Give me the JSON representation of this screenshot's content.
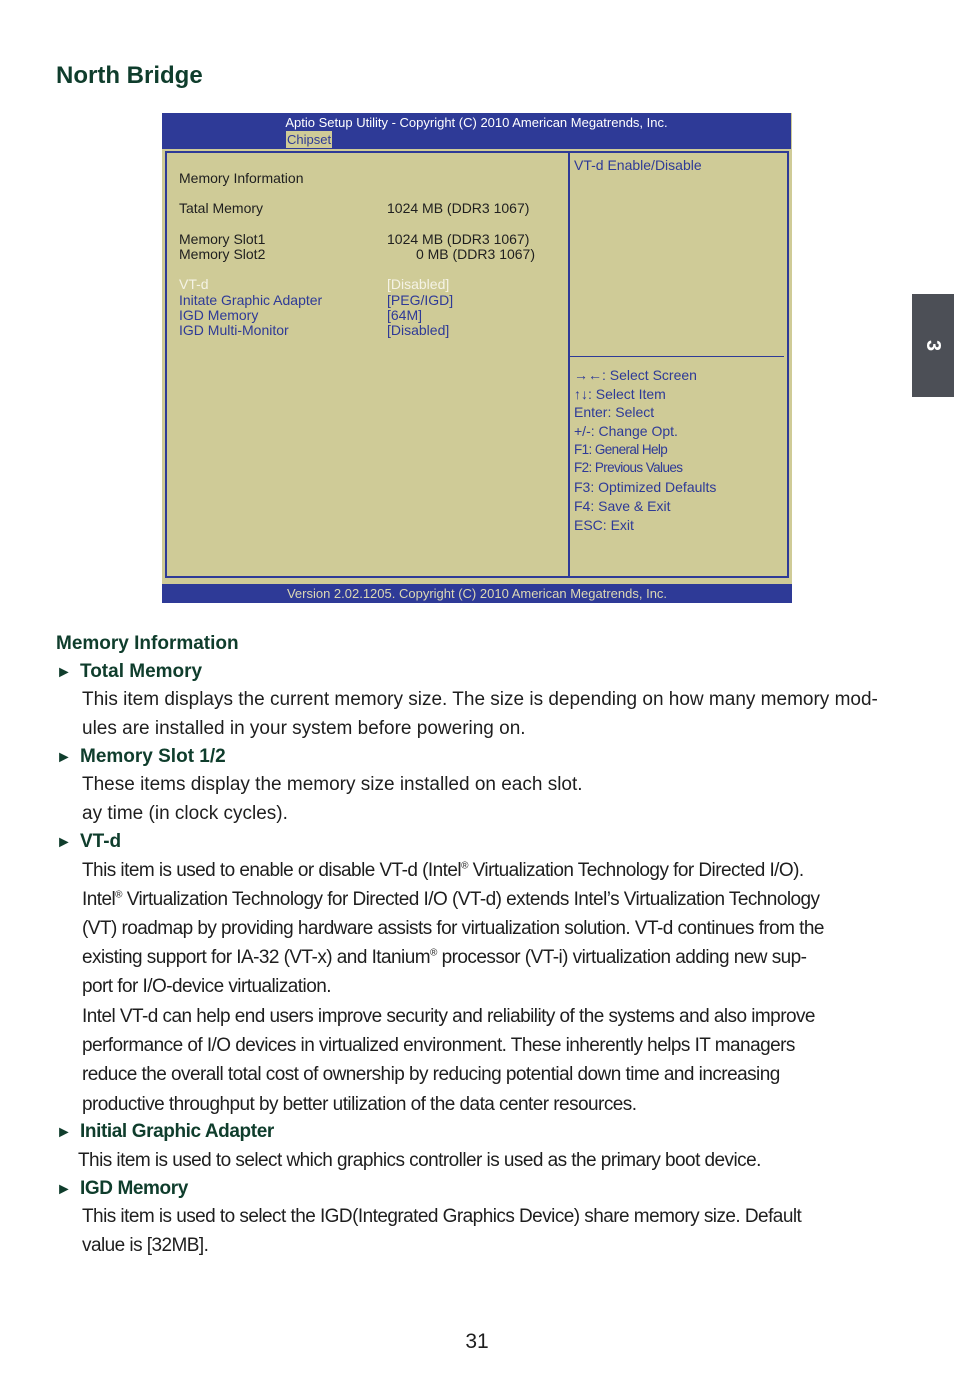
{
  "page": {
    "title": "North Bridge",
    "chapter_tab": "3",
    "page_number": "31"
  },
  "bios": {
    "header_title": "Aptio Setup Utility - Copyright (C) 2010 American Megatrends, Inc.",
    "active_tab": "Chipset",
    "footer": "Version 2.02.1205. Copyright (C) 2010 American Megatrends, Inc.",
    "section_label": "Memory Information",
    "info_rows": [
      {
        "label": "Tatal Memory",
        "value": "1024 MB (DDR3 1067)"
      },
      {
        "label": "Memory Slot1",
        "value": "1024 MB (DDR3 1067)"
      },
      {
        "label": "Memory Slot2",
        "value": "0 MB (DDR3 1067)"
      }
    ],
    "settings": [
      {
        "label": "VT-d",
        "value": "[Disabled]",
        "selected": true
      },
      {
        "label": "Initate Graphic Adapter",
        "value": "[PEG/IGD]"
      },
      {
        "label": "IGD Memory",
        "value": "[64M]"
      },
      {
        "label": "IGD Multi-Monitor",
        "value": "[Disabled]"
      }
    ],
    "help_title": "VT-d Enable/Disable",
    "keys": [
      "→←: Select Screen",
      "↑↓: Select Item",
      "Enter: Select",
      "+/-: Change Opt.",
      "F1:  General Help",
      "F2:  Previous Values",
      "F3: Optimized Defaults",
      "F4: Save & Exit",
      "ESC: Exit"
    ],
    "colors": {
      "bar": "#2e3a97",
      "panel": "#cfcb97"
    }
  },
  "doc": {
    "memory_info_heading": "Memory Information",
    "bullet_glyph": "►",
    "total_memory": {
      "heading": "Total Memory",
      "lines": [
        "This item displays the current memory size. The size is depending on how many memory mod-",
        "ules are installed in your system before powering on."
      ]
    },
    "memory_slot": {
      "heading": "Memory Slot 1/2",
      "lines": [
        "These items display the memory size installed on each slot.",
        "ay time (in clock cycles)."
      ]
    },
    "vtd": {
      "heading": "VT-d",
      "line1a": "This item is used to enable or disable VT-d (Intel",
      "line1b": " Virtualization Technology for Directed I/O).",
      "line2a": "Intel",
      "line2b": " Virtualization Technology for Directed I/O (VT-d) extends Intel’s Virtualization Technology",
      "line3": "(VT) roadmap by providing hardware assists for virtualization solution. VT-d continues from the",
      "line4a": "existing support for IA-32 (VT-x) and Itanium",
      "line4b": " processor (VT-i) virtualization adding new sup-",
      "line5": "port for I/O-device virtualization.",
      "reg": "®",
      "para2": [
        "Intel VT-d can help end users improve security and reliability of the systems and also improve",
        "performance of I/O devices in virtualized environment. These inherently helps IT managers",
        "reduce the overall total cost of ownership by reducing potential down time and increasing",
        "productive throughput by better utilization of the data center resources."
      ]
    },
    "initial_graphic": {
      "heading": "Initial Graphic Adapter",
      "line": "This item is used to select which graphics controller is used as the primary boot device."
    },
    "igd_memory": {
      "heading": "IGD Memory",
      "lines": [
        "This item is used to select the IGD(Integrated Graphics Device) share memory size. Default",
        "value is [32MB]."
      ]
    }
  }
}
